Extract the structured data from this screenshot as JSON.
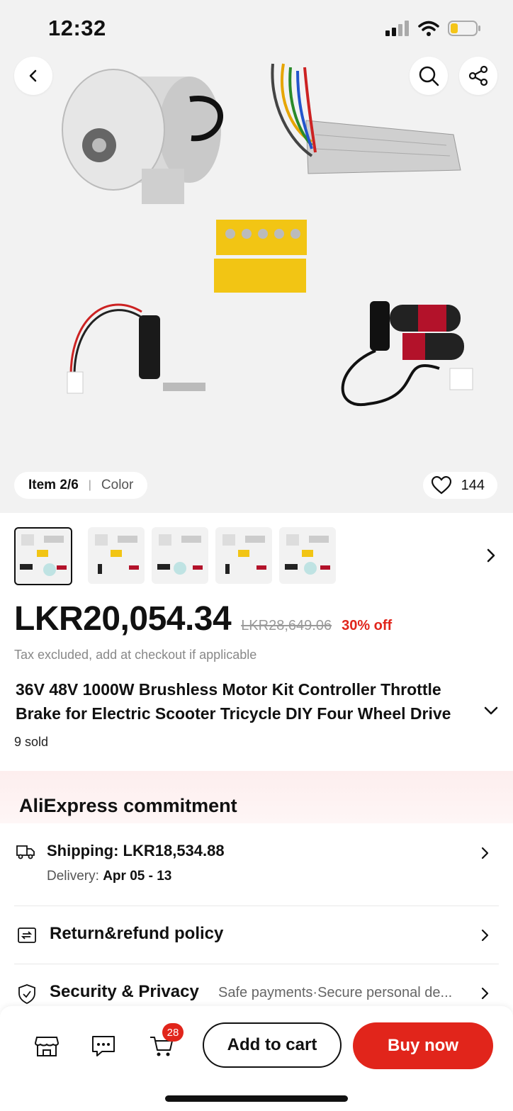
{
  "status_bar": {
    "time": "12:32"
  },
  "gallery": {
    "item_index": "Item 2/6",
    "variant_label": "Color",
    "likes": "144"
  },
  "thumbnails": [
    {
      "name": "thumb-1",
      "selected": true
    },
    {
      "name": "thumb-2",
      "selected": false
    },
    {
      "name": "thumb-3",
      "selected": false
    },
    {
      "name": "thumb-4",
      "selected": false
    },
    {
      "name": "thumb-5",
      "selected": false
    }
  ],
  "price": {
    "current": "LKR20,054.34",
    "original": "LKR28,649.06",
    "discount": "30% off",
    "tax_note": "Tax excluded, add at checkout if applicable"
  },
  "product": {
    "title_line1": "36V 48V 1000W Brushless Motor Kit Controller Throttle",
    "title_line2": "Brake for Electric Scooter Tricycle DIY Four Wheel Drive",
    "sold": "9 sold"
  },
  "commitment": {
    "title": "AliExpress commitment",
    "shipping_label": "Shipping: LKR18,534.88",
    "delivery_prefix": "Delivery:",
    "delivery_dates": "Apr 05 - 13",
    "return_label": "Return&refund policy",
    "security_label": "Security & Privacy",
    "security_detail": "Safe payments·Secure personal de..."
  },
  "bottom_bar": {
    "cart_count": "28",
    "add_to_cart": "Add to cart",
    "buy_now": "Buy now"
  },
  "colors": {
    "accent": "#e1251b",
    "band": "#fdeeee"
  }
}
